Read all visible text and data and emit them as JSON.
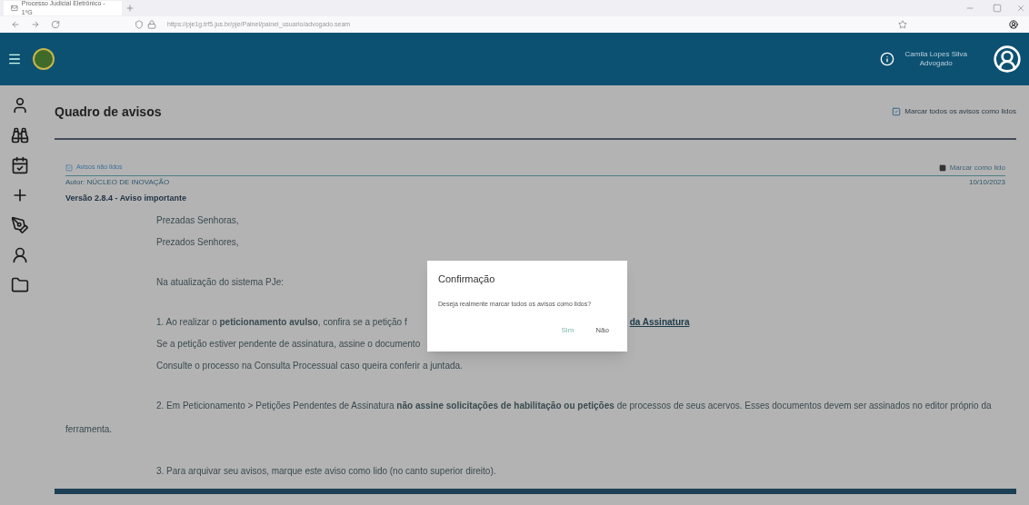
{
  "browser": {
    "tab_title": "Processo Judicial Eletrônico - 1ºG",
    "url": "https://pje1g.trf5.jus.br/pje/Painel/painel_usuario/advogado.seam"
  },
  "header": {
    "user_name": "Camila Lopes Silva",
    "user_role": "Advogado"
  },
  "page": {
    "title": "Quadro de avisos",
    "mark_all": "Marcar todos os avisos como lidos"
  },
  "notice": {
    "filter": "Avisos não lidos",
    "author": "Autor: NÚCLEO DE INOVAÇÃO",
    "date": "10/10/2023",
    "mark_read": "Marcar como lido",
    "heading": "Versão 2.8.4 - Aviso importante",
    "lines": [
      {
        "kind": "line",
        "text": "Prezadas Senhoras,"
      },
      {
        "kind": "line",
        "text": "Prezados Senhores,"
      },
      {
        "kind": "gap"
      },
      {
        "kind": "line",
        "text": "Na atualização do sistema PJe:"
      },
      {
        "kind": "gap"
      },
      {
        "kind": "split",
        "text": "1. Ao realizar o **peticionamento avulso**, confira se a petição f",
        "link": "da Assinatura"
      },
      {
        "kind": "line",
        "text": "Se a petição estiver pendente de assinatura, assine o documento"
      },
      {
        "kind": "line",
        "text": "Consulte o processo na Consulta Processual caso queira conferir a juntada."
      },
      {
        "kind": "gap"
      },
      {
        "kind": "wrap",
        "text": "2. Em Peticionamento > Petições Pendentes de Assinatura **não assine solicitações de habilitação ou petições** de processos de seus acervos. Esses documentos devem ser assinados no editor próprio da ferramenta."
      },
      {
        "kind": "gap"
      },
      {
        "kind": "line",
        "text": "3. Para arquivar seu avisos, marque este aviso como lido (no canto superior direito)."
      }
    ]
  },
  "dialog": {
    "title": "Confirmação",
    "message": "Deseja realmente marcar todos os avisos como lidos?",
    "buttons": [
      {
        "label": "Sim",
        "kind": "primary"
      },
      {
        "label": "Não",
        "kind": "secondary"
      }
    ]
  }
}
